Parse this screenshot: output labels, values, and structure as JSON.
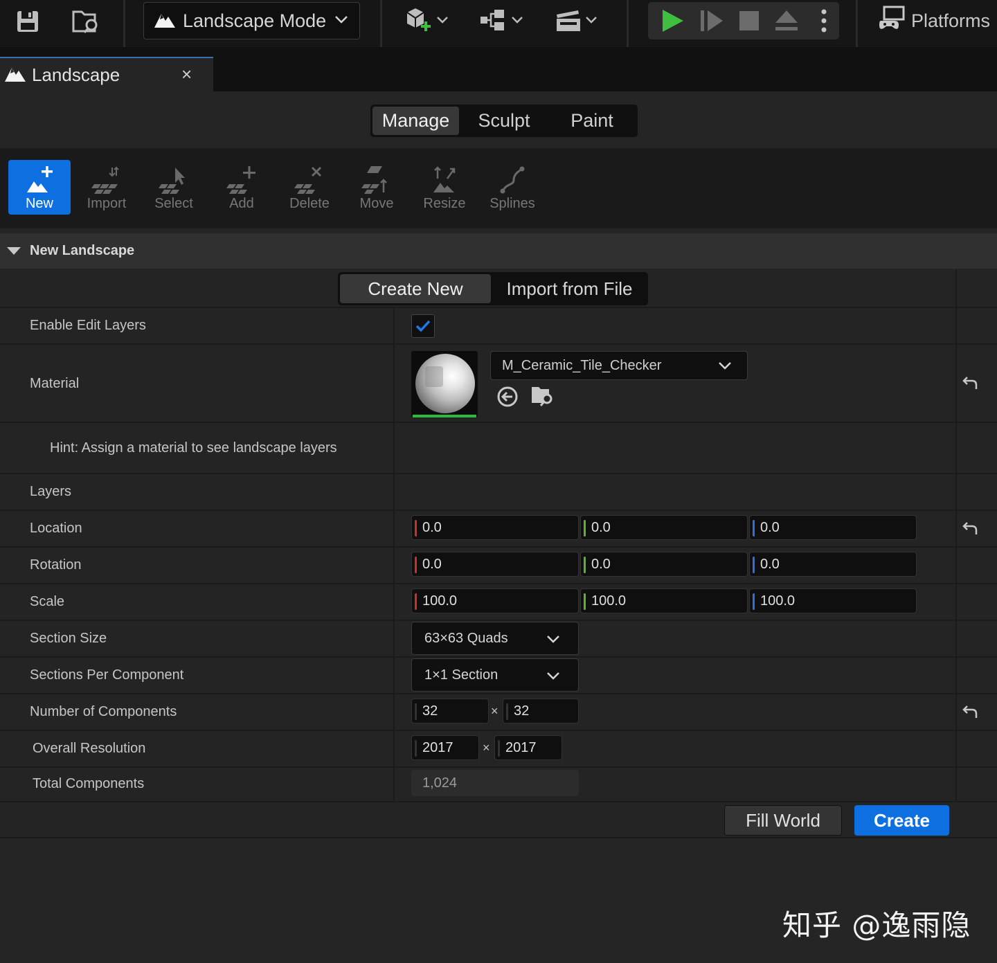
{
  "toolbar": {
    "mode_label": "Landscape Mode",
    "platforms_label": "Platforms",
    "icons": [
      "save-icon",
      "content-browser-icon",
      "landscape-mode-icon",
      "chevron-down-icon",
      "add-actor-icon",
      "blueprint-icon",
      "cinematics-icon",
      "play-icon",
      "advance-frame-icon",
      "stop-icon",
      "eject-icon",
      "more-options-icon",
      "platforms-icon"
    ],
    "play_color": "#3fbf3f"
  },
  "tab": {
    "label": "Landscape",
    "close": "×"
  },
  "modes": [
    {
      "label": "Manage",
      "active": true
    },
    {
      "label": "Sculpt",
      "active": false
    },
    {
      "label": "Paint",
      "active": false
    }
  ],
  "tools": [
    {
      "label": "New",
      "icon": "new-landscape-icon",
      "active": true
    },
    {
      "label": "Import",
      "icon": "import-icon",
      "active": false
    },
    {
      "label": "Select",
      "icon": "select-icon",
      "active": false
    },
    {
      "label": "Add",
      "icon": "add-component-icon",
      "active": false
    },
    {
      "label": "Delete",
      "icon": "delete-component-icon",
      "active": false
    },
    {
      "label": "Move",
      "icon": "move-icon",
      "active": false
    },
    {
      "label": "Resize",
      "icon": "resize-icon",
      "active": false
    },
    {
      "label": "Splines",
      "icon": "splines-icon",
      "active": false
    }
  ],
  "category": {
    "label": "New Landscape"
  },
  "create_tabs": [
    {
      "label": "Create New",
      "active": true
    },
    {
      "label": "Import from File",
      "active": false
    }
  ],
  "props": {
    "enable_edit_layers": {
      "label": "Enable Edit Layers",
      "checked": true
    },
    "material": {
      "label": "Material",
      "value": "M_Ceramic_Tile_Checker"
    },
    "hint": "Hint: Assign a material to see landscape layers",
    "layers": {
      "label": "Layers"
    },
    "location": {
      "label": "Location",
      "x": "0.0",
      "y": "0.0",
      "z": "0.0"
    },
    "rotation": {
      "label": "Rotation",
      "x": "0.0",
      "y": "0.0",
      "z": "0.0"
    },
    "scale": {
      "label": "Scale",
      "x": "100.0",
      "y": "100.0",
      "z": "100.0"
    },
    "section_size": {
      "label": "Section Size",
      "value": "63×63 Quads"
    },
    "sections_per_component": {
      "label": "Sections Per Component",
      "value": "1×1 Section"
    },
    "number_of_components": {
      "label": "Number of Components",
      "x": "32",
      "y": "32",
      "sep": "×"
    },
    "overall_resolution": {
      "label": "Overall Resolution",
      "x": "2017",
      "y": "2017",
      "sep": "×"
    },
    "total_components": {
      "label": "Total Components",
      "value": "1,024"
    }
  },
  "actions": {
    "fill_world": "Fill World",
    "create": "Create"
  },
  "axis_colors": {
    "x": "#d0302a",
    "y": "#5cb531",
    "z": "#2f6fdc"
  },
  "accent": "#0e70e0",
  "watermark": "知乎 @逸雨隐"
}
